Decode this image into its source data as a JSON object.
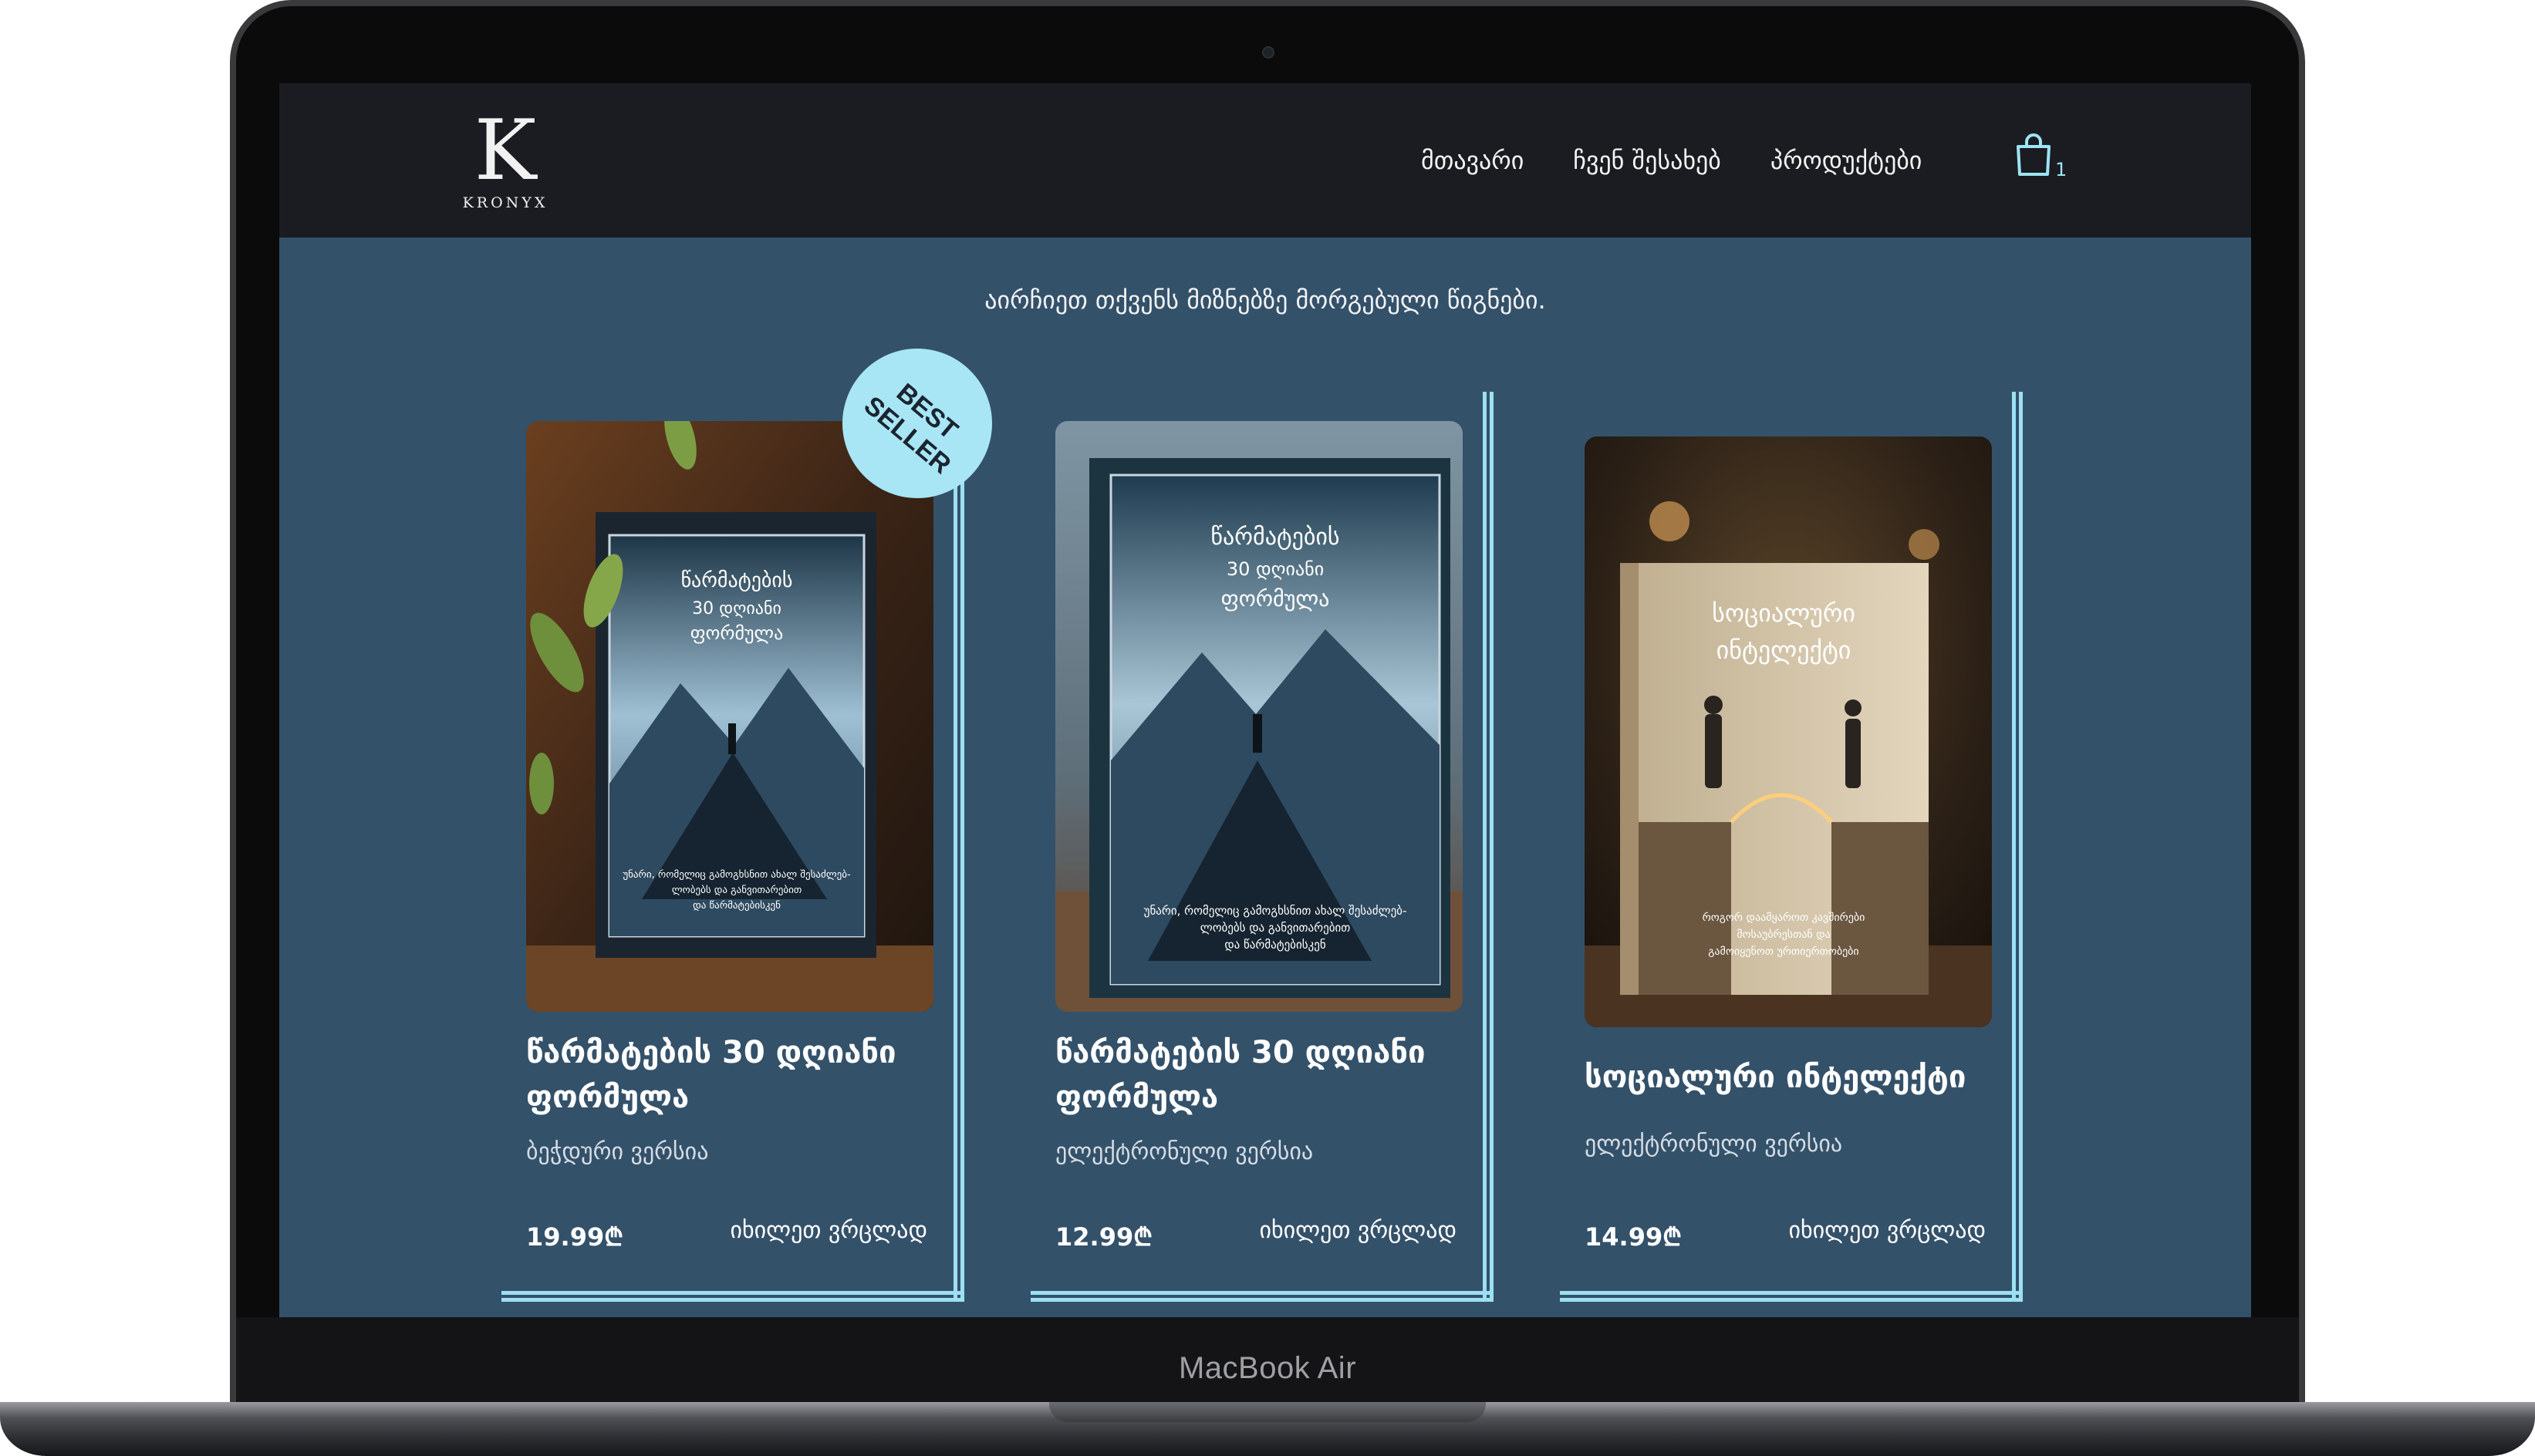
{
  "device": {
    "model_label": "MacBook Air"
  },
  "header": {
    "logo_letter": "K",
    "logo_text": "KRONYX",
    "nav": [
      {
        "label": "მთავარი"
      },
      {
        "label": "ჩვენ შესახებ"
      },
      {
        "label": "პროდუქტები"
      }
    ],
    "cart_count": "1",
    "cart_icon": "shopping-bag-icon"
  },
  "main": {
    "tagline": "აირჩიეთ თქვენს მიზნებზე მორგებული წიგნები.",
    "badge": {
      "line1": "BEST",
      "line2": "SELLER"
    },
    "products": [
      {
        "title": "წარმატების 30 დღიანი ფორმულა",
        "version": "ბეჭდური ვერსია",
        "price": "19.99₾",
        "more": "იხილეთ ვრცლად",
        "cover_title": [
          "წარმატების",
          "30 დღიანი",
          "ფორმულა"
        ],
        "cover_blurb": [
          "უნარი, რომელიც გამოგხსნით ახალ შესაძლებ-",
          "ლობებს და განვითარებით",
          "და წარმატებისკენ"
        ]
      },
      {
        "title": "წარმატების 30 დღიანი ფორმულა",
        "version": "ელექტრონული ვერსია",
        "price": "12.99₾",
        "more": "იხილეთ ვრცლად",
        "cover_title": [
          "წარმატების",
          "30 დღიანი",
          "ფორმულა"
        ],
        "cover_blurb": [
          "უნარი, რომელიც გამოგხსნით ახალ შესაძლებ-",
          "ლობებს და განვითარებით",
          "და წარმატებისკენ"
        ]
      },
      {
        "title": "სოციალური ინტელექტი",
        "version": "ელექტრონული ვერსია",
        "price": "14.99₾",
        "more": "იხილეთ ვრცლად",
        "cover_title": [
          "სოციალური",
          "ინტელექტი"
        ],
        "cover_blurb": [
          "როგორ დაამყაროთ კავშირები",
          "მოსაუბრესთან და",
          "გამოიყენოთ ურთიერთობები"
        ]
      }
    ]
  },
  "colors": {
    "screen_bg": "#34516a",
    "navbar_bg": "#1a1c21",
    "accent": "#9ce0f2",
    "badge": "#a8e6f5"
  }
}
